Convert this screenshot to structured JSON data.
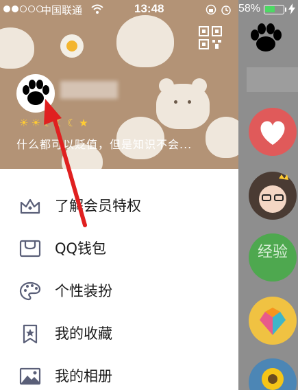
{
  "status_bar": {
    "carrier": "中国联通",
    "time": "13:48",
    "battery_percent": "58%",
    "battery_level": 0.58
  },
  "profile": {
    "signature": "什么都可以贬值，但是知识不会..."
  },
  "menu": {
    "items": [
      {
        "label": "了解会员特权",
        "icon": "crown-icon"
      },
      {
        "label": "QQ钱包",
        "icon": "wallet-icon"
      },
      {
        "label": "个性装扮",
        "icon": "palette-icon"
      },
      {
        "label": "我的收藏",
        "icon": "bookmark-star-icon"
      },
      {
        "label": "我的相册",
        "icon": "photo-album-icon"
      }
    ]
  },
  "background_list": {
    "items": [
      {
        "name": "heart-avatar"
      },
      {
        "name": "girl-avatar"
      },
      {
        "name": "jingyan-avatar",
        "text": "经验"
      },
      {
        "name": "colorful-heart-avatar"
      },
      {
        "name": "sunflower-avatar"
      }
    ]
  },
  "colors": {
    "header_bg": "#b39376",
    "arrow": "#e02020",
    "battery_fill": "#4cd964"
  }
}
